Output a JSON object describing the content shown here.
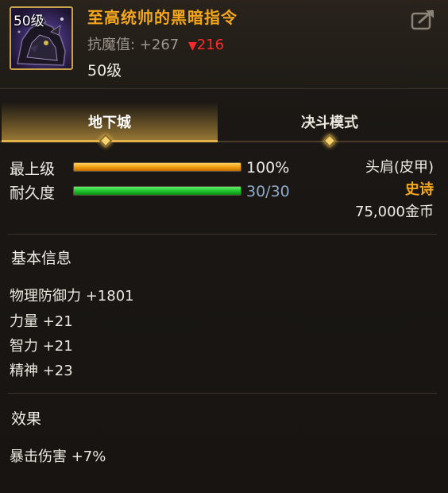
{
  "item": {
    "icon_level": "50级",
    "name": "至高统帅的黑暗指令",
    "stat_label": "抗魔值: +267",
    "stat_change_arrow": "▼",
    "stat_change_value": "216",
    "level": "50级"
  },
  "tabs": [
    {
      "label": "地下城",
      "active": true
    },
    {
      "label": "决斗模式",
      "active": false
    }
  ],
  "bars": {
    "highest": {
      "label": "最上级",
      "value_text": "100%",
      "fraction": 1.0
    },
    "durability": {
      "label": "耐久度",
      "value_text": "30/30",
      "fraction": 1.0
    }
  },
  "info": {
    "slot": "头肩(皮甲)",
    "rarity": "史诗",
    "price": "75,000金币"
  },
  "basic_info": {
    "title": "基本信息",
    "attributes": [
      "物理防御力 +1801",
      "力量 +21",
      "智力 +21",
      "精神 +23"
    ]
  },
  "effects": {
    "title": "效果",
    "items": [
      "暴击伤害 +7%"
    ]
  },
  "colors": {
    "item_name": "#f4a61c",
    "rarity": "#f4a61c",
    "stat_down": "#ff2a2a",
    "durability_value": "#8fa9c8"
  }
}
